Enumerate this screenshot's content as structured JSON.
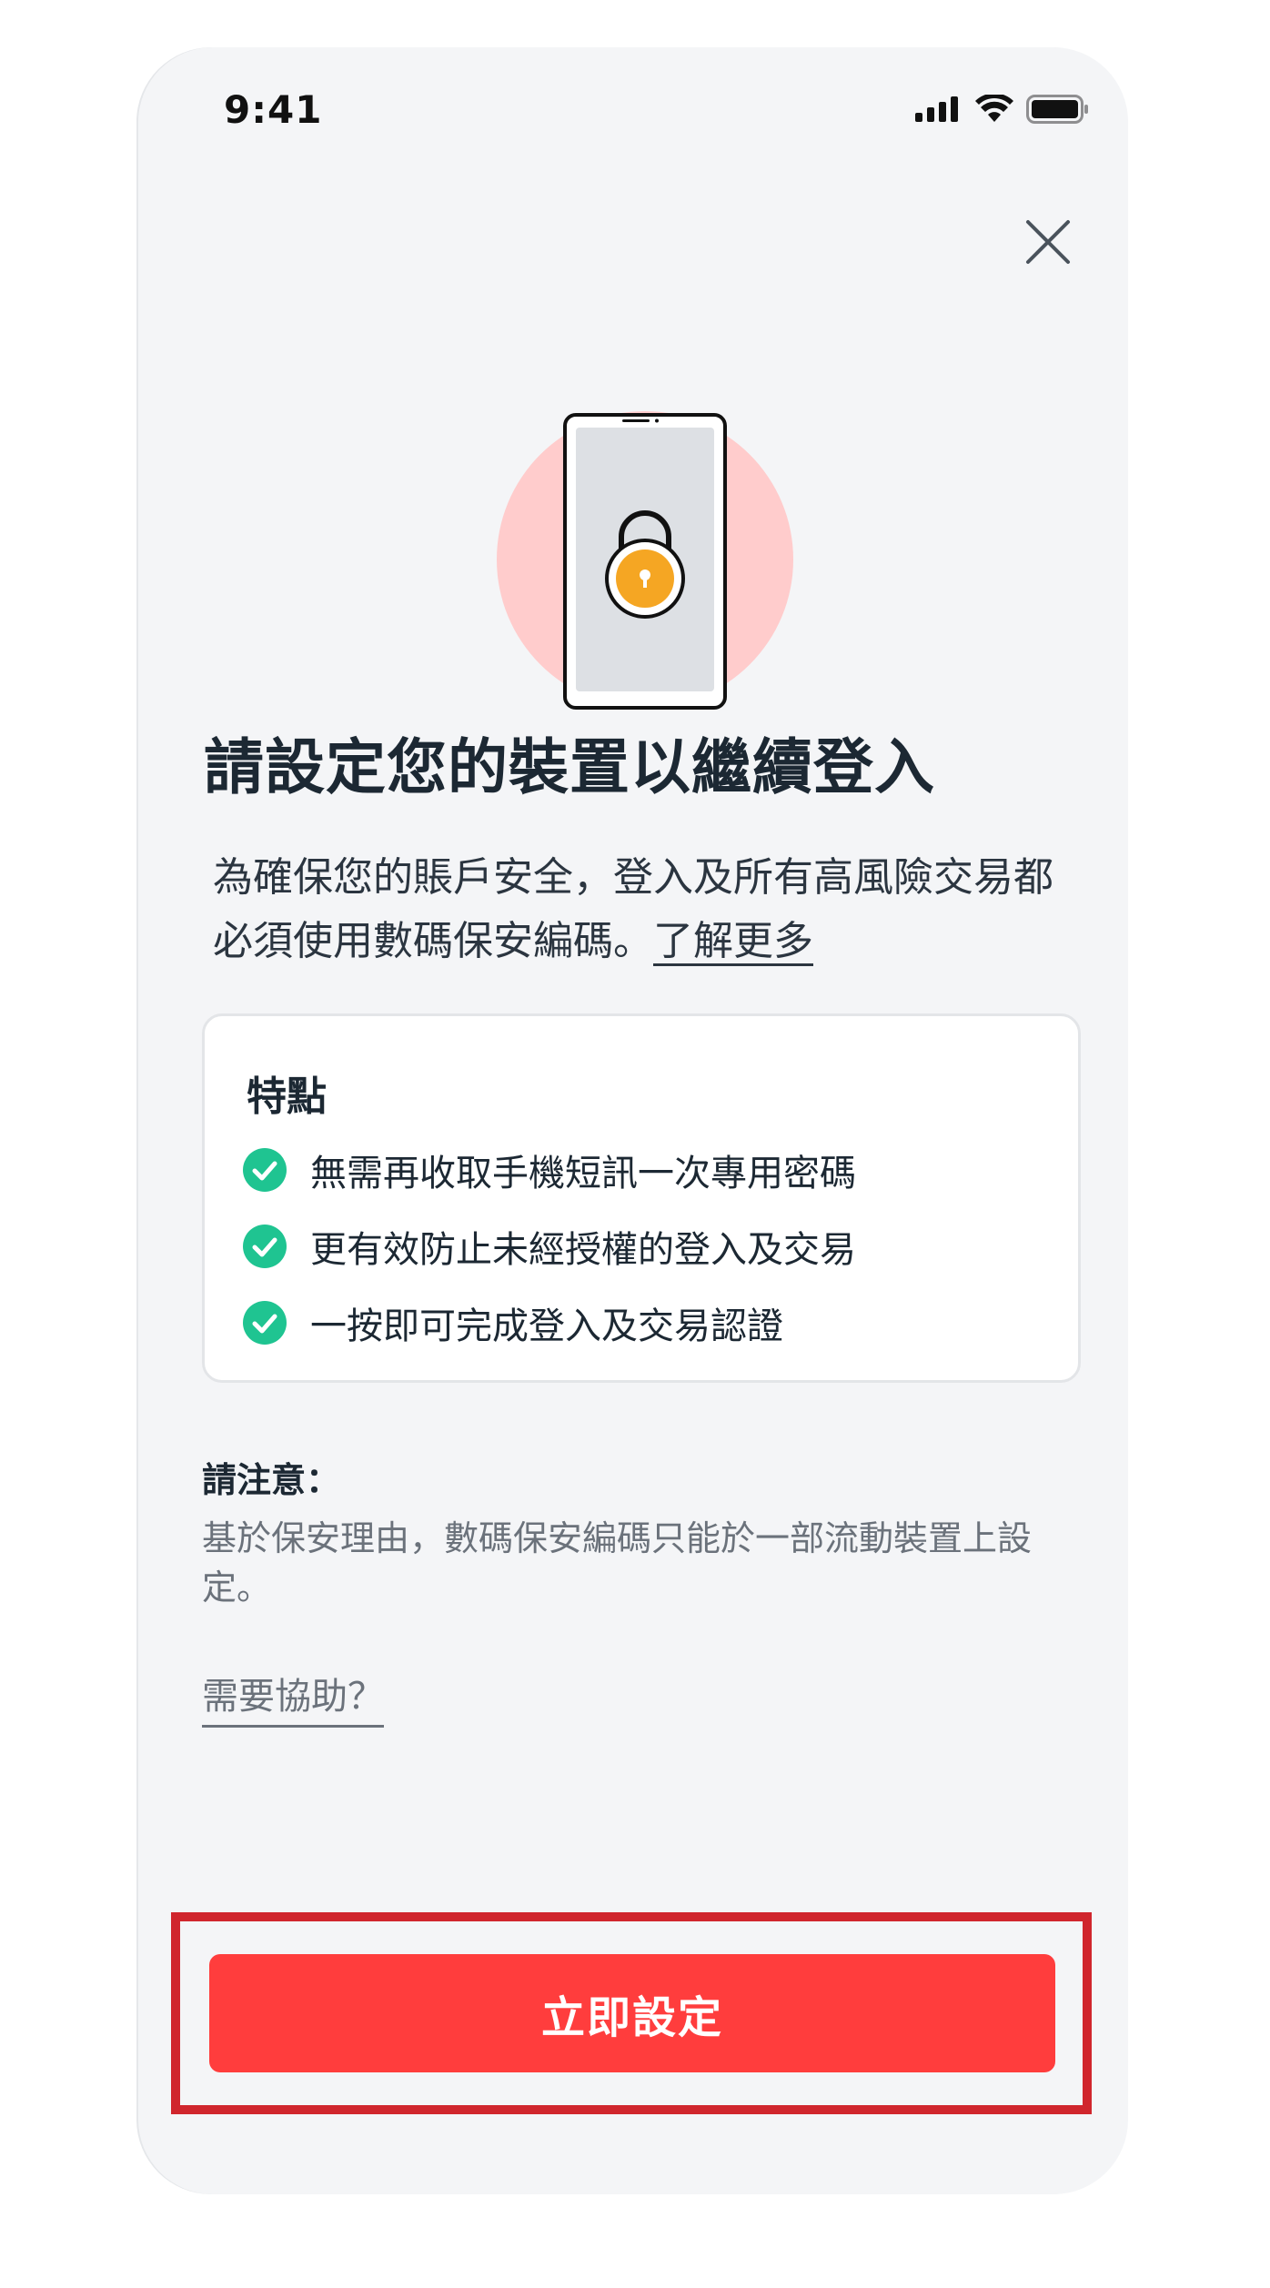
{
  "status_bar": {
    "time": "9:41",
    "icons": [
      "cellular-signal-icon",
      "wifi-icon",
      "battery-icon"
    ]
  },
  "close_icon": "close-icon",
  "hero_icons": [
    "phone-icon",
    "padlock-icon"
  ],
  "title": "請設定您的裝置以繼續登入",
  "description": {
    "text": "為確保您的賬戶安全，登入及所有高風險交易都必須使用數碼保安編碼。",
    "learn_more": "了解更多"
  },
  "features": {
    "title": "特點",
    "items": [
      "無需再收取手機短訊一次專用密碼",
      "更有效防止未經授權的登入及交易",
      "一按即可完成登入及交易認證"
    ]
  },
  "notice": {
    "title": "請注意：",
    "body": "基於保安理由，數碼保安編碼只能於一部流動裝置上設定。"
  },
  "help_link": "需要協助？",
  "cta_button": "立即設定",
  "colors": {
    "accent": "#ff3d3d",
    "highlight_border": "#d0262d",
    "check": "#1fc491",
    "lock": "#f5a623",
    "hero_circle": "#ffcccc",
    "background": "#f4f5f7"
  }
}
